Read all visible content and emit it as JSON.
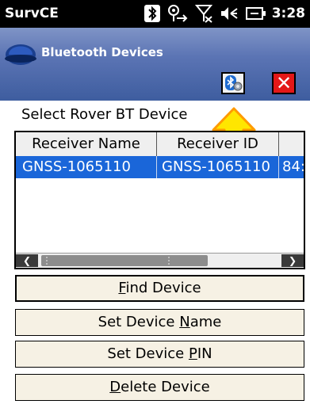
{
  "status_bar": {
    "app_name": "SurvCE",
    "time": "3:28",
    "icons": [
      "bluetooth-icon",
      "connectivity-icon",
      "signal-off-icon",
      "volume-icon",
      "battery-icon"
    ]
  },
  "window": {
    "title": "Bluetooth Devices",
    "buttons": {
      "bluetooth": "bluetooth-settings-icon",
      "close": "✕"
    }
  },
  "section_label": "Select Rover BT Device",
  "table": {
    "columns": [
      "Receiver Name",
      "Receiver ID",
      ""
    ],
    "rows": [
      {
        "name": "GNSS-1065110",
        "id": "GNSS-1065110",
        "address": "84:"
      }
    ]
  },
  "actions": {
    "find": {
      "pre": "",
      "u": "F",
      "post": "ind Device"
    },
    "set_name": {
      "pre": "Set Device ",
      "u": "N",
      "post": "ame"
    },
    "set_pin": {
      "pre": "Set Device ",
      "u": "P",
      "post": "IN"
    },
    "delete": {
      "pre": "",
      "u": "D",
      "post": "elete Device"
    }
  },
  "colors": {
    "selection": "#1a66d9",
    "close": "#e31818",
    "arrow": "#ffe600",
    "title_gradient_top": "#7f94c6",
    "title_gradient_bottom": "#3e5d9f"
  }
}
